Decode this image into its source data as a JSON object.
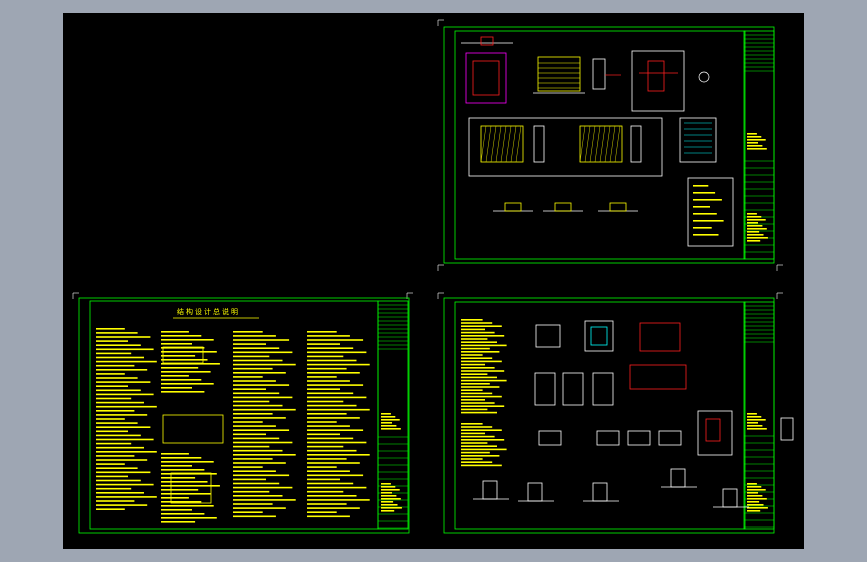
{
  "colors": {
    "background": "#000000",
    "frame": "#00ff00",
    "text": "#ffff00",
    "accent_red": "#ff2020",
    "accent_magenta": "#ff00ff",
    "linework": "#ffffff",
    "cyan": "#00ffff",
    "outer": "#9ea6b3"
  },
  "sheets": [
    {
      "id": "sheet-top-right"
    },
    {
      "id": "sheet-bottom-left",
      "title": "结构设计总说明"
    },
    {
      "id": "sheet-bottom-right"
    }
  ]
}
